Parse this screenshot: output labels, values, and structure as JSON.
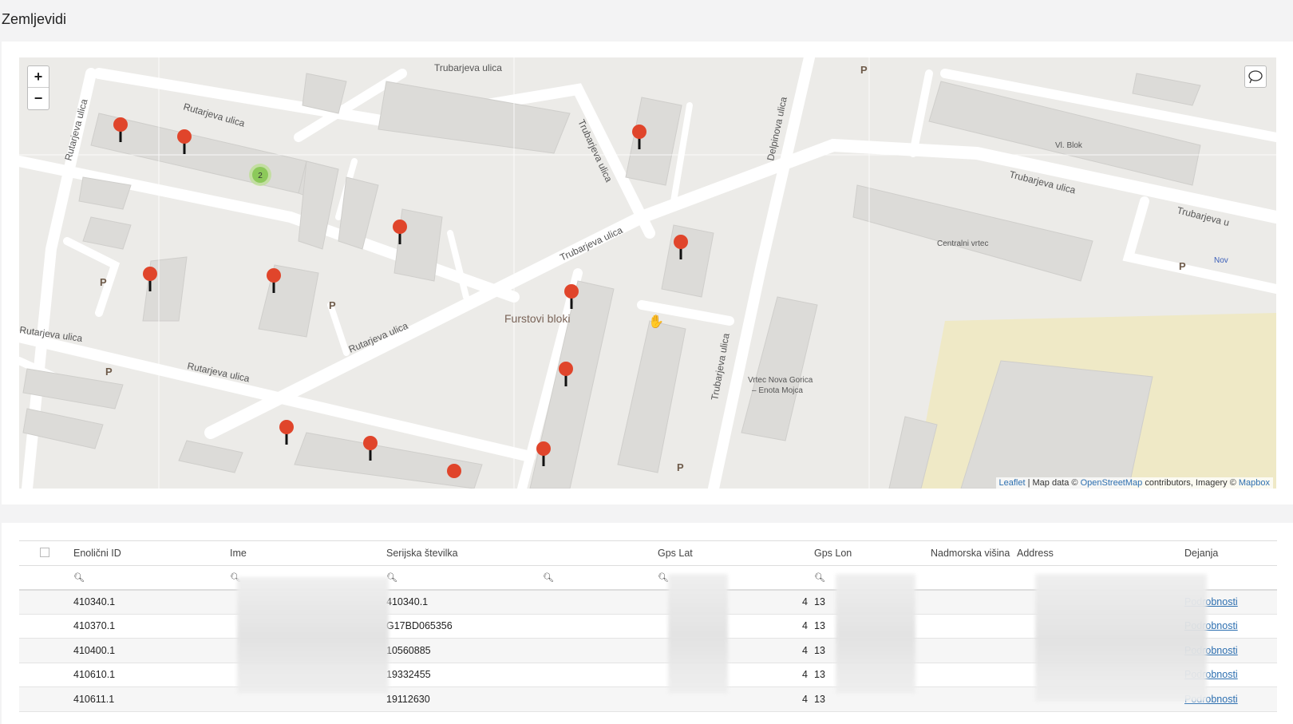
{
  "page": {
    "title": "Zemljevidi"
  },
  "map": {
    "zoom_in": "+",
    "zoom_out": "−",
    "streets": [
      "Trubarjeva ulica",
      "Rutarjeva ulica",
      "Rutarjeva ulica",
      "Trubarjeva ulica",
      "Delpinova ulica",
      "Trubarjeva ulica",
      "Trubarjeva u",
      "Rutarjeva ulica",
      "Rutarjeva ulica",
      "Trubarjeva ulica",
      "Rutarjeva ulica",
      "Rutarjeva ulica",
      "Trubarjeva ulica"
    ],
    "places": [
      "Furstovi bloki",
      "Vl. Blok",
      "Centralni vrtec",
      "Vrtec Nova Gorica",
      "– Enota Mojca",
      "Nov"
    ],
    "parking_label": "P",
    "cluster_count": "2",
    "attribution": {
      "leaflet": "Leaflet",
      "text1": " | Map data © ",
      "osm": "OpenStreetMap",
      "text2": " contributors, Imagery © ",
      "mapbox": "Mapbox"
    }
  },
  "table": {
    "columns": [
      "Enolični ID",
      "Ime",
      "Serijska številka",
      "Gps Lat",
      "Gps Lon",
      "Nadmorska višina",
      "Address",
      "Dejanja"
    ],
    "rows": [
      {
        "id": "410340.1",
        "serial": "410340.1",
        "lat": "4",
        "lon": "13",
        "action": "Podrobnosti"
      },
      {
        "id": "410370.1",
        "serial": "G17BD065356",
        "lat": "4",
        "lon": "13",
        "action": "Podrobnosti"
      },
      {
        "id": "410400.1",
        "serial": "10560885",
        "lat": "4",
        "lon": "13",
        "action": "Podrobnosti"
      },
      {
        "id": "410610.1",
        "serial": "19332455",
        "lat": "4",
        "lon": "13",
        "action": "Podrobnosti"
      },
      {
        "id": "410611.1",
        "serial": "19112630",
        "lat": "4",
        "lon": "13",
        "action": "Podrobnosti"
      }
    ]
  },
  "icons": {
    "search": "search-icon",
    "lasso": "lasso-icon",
    "marker": "map-marker-icon"
  },
  "colors": {
    "marker": "#e0452b",
    "cluster": "#9fd56b",
    "link": "#2d6fb0",
    "park": "#f0e9bd"
  }
}
